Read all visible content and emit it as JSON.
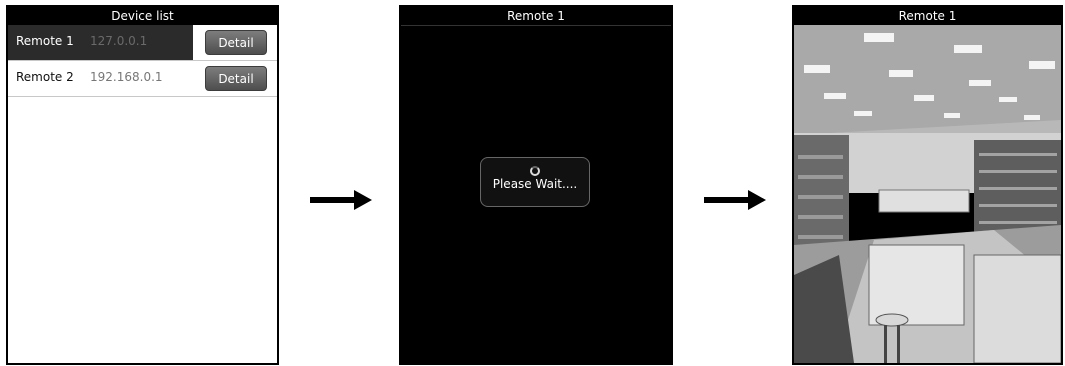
{
  "screen1": {
    "title": "Device list",
    "devices": [
      {
        "name": "Remote 1",
        "address": "127.0.0.1",
        "button": "Detail",
        "selected": true
      },
      {
        "name": "Remote 2",
        "address": "192.168.0.1",
        "button": "Detail",
        "selected": false
      }
    ]
  },
  "screen2": {
    "title": "Remote 1",
    "dialog": {
      "icon": "spinner-icon",
      "message": "Please Wait...."
    }
  },
  "screen3": {
    "title": "Remote 1",
    "image": "store-interior-camera-feed"
  },
  "arrows": [
    "arrow-right-icon",
    "arrow-right-icon"
  ]
}
